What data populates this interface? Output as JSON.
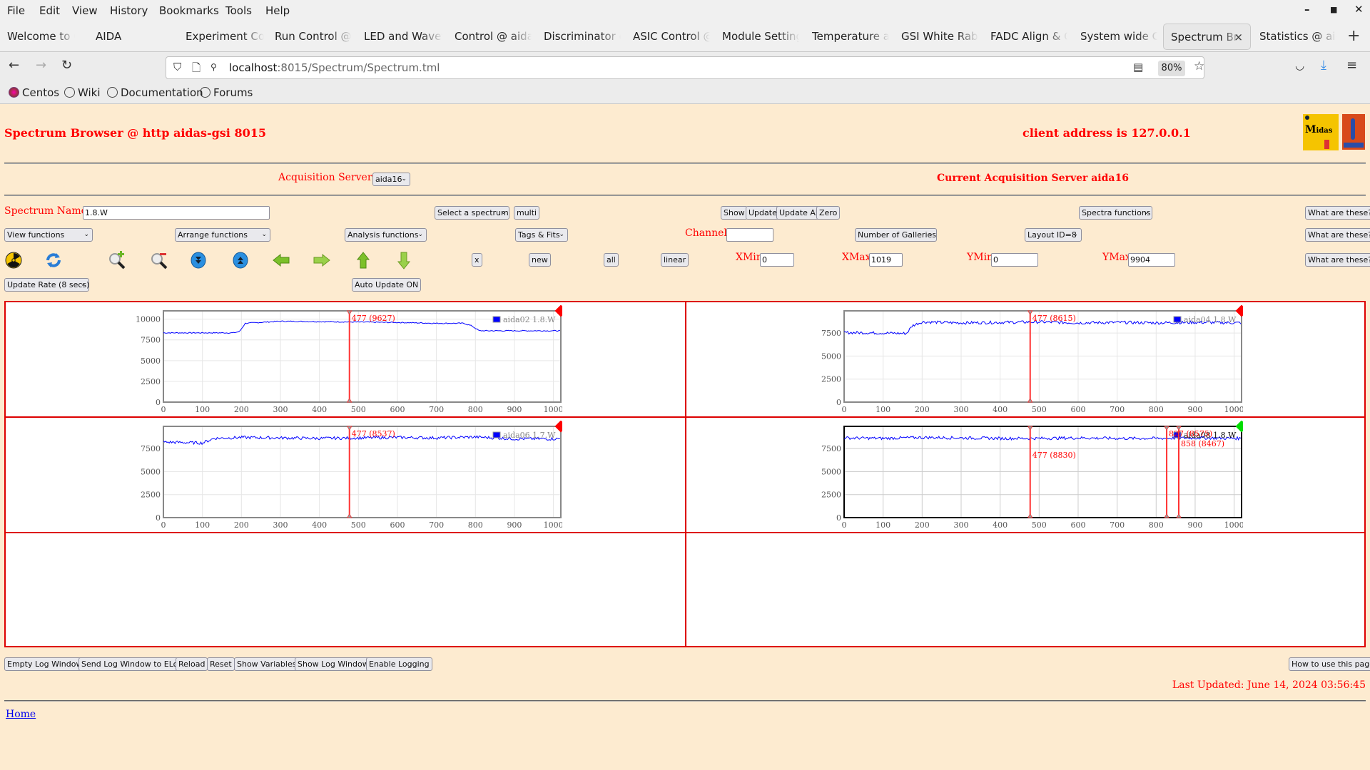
{
  "browser": {
    "menu": [
      "File",
      "Edit",
      "View",
      "History",
      "Bookmarks",
      "Tools",
      "Help"
    ],
    "tabs": [
      {
        "label": "Welcome to Centos",
        "active": false
      },
      {
        "label": "AIDA",
        "active": false
      },
      {
        "label": "Experiment Control",
        "active": false
      },
      {
        "label": "Run Control @ aidas",
        "active": false
      },
      {
        "label": "LED and Waveform",
        "active": false
      },
      {
        "label": "Control @ aidas",
        "active": false
      },
      {
        "label": "Discriminator control",
        "active": false
      },
      {
        "label": "ASIC Control @",
        "active": false
      },
      {
        "label": "Module Settings",
        "active": false
      },
      {
        "label": "Temperature and",
        "active": false
      },
      {
        "label": "GSI White Rabbit",
        "active": false
      },
      {
        "label": "FADC Align & Control",
        "active": false
      },
      {
        "label": "System wide Checks",
        "active": false
      },
      {
        "label": "Spectrum Browser",
        "active": true
      },
      {
        "label": "Statistics @ aidas",
        "active": false
      }
    ],
    "url_host": "localhost",
    "url_rest": ":8015/Spectrum/Spectrum.tml",
    "zoom_level": "80%",
    "bookmarks": [
      "Centos",
      "Wiki",
      "Documentation",
      "Forums"
    ]
  },
  "page": {
    "title": "Spectrum Browser @ http aidas-gsi 8015",
    "client_address": "client address is 127.0.0.1",
    "acq_servers_label": "Acquisition Servers",
    "acq_server_selected": "aida16",
    "current_server": "Current Acquisition Server aida16",
    "spectrum_name_label": "Spectrum Name:",
    "spectrum_name_value": "1.8.W",
    "select_spectrum": "Select a spectrum",
    "multi": "multi",
    "show": "Show",
    "update": "Update",
    "update_all": "Update All",
    "zero": "Zero",
    "spectra_functions": "Spectra functions",
    "what_are_these": "What are these?",
    "view_functions": "View functions",
    "arrange_functions": "Arrange functions",
    "analysis_functions": "Analysis functions",
    "tags_fits": "Tags & Fits",
    "channel_label": "Channel:",
    "channel_value": "",
    "number_of_galleries": "Number of Galleries",
    "layout_id": "Layout ID=8",
    "x_btn": "x",
    "new_btn": "new",
    "all_btn": "all",
    "linear_btn": "linear",
    "xmin_label": "XMin",
    "xmin_value": "0",
    "xmax_label": "XMax",
    "xmax_value": "1019",
    "ymin_label": "YMin",
    "ymin_value": "0",
    "ymax_label": "YMax",
    "ymax_value": "9904",
    "update_rate": "Update Rate (8 secs)",
    "auto_update": "Auto Update ON",
    "bottom_buttons": [
      "Empty Log Window",
      "Send Log Window to ELog",
      "Reload",
      "Reset",
      "Show Variables",
      "Show Log Window",
      "Enable Logging"
    ],
    "how_to_use": "How to use this page",
    "last_updated": "Last Updated: June 14, 2024 03:56:45",
    "home_link": "Home",
    "toolbar_icons": [
      "radiation-icon",
      "refresh-icon",
      "zoom-in-icon",
      "zoom-out-icon",
      "expand-down-icon",
      "expand-up-icon",
      "arrow-left-icon",
      "arrow-right-icon",
      "arrow-up-icon",
      "arrow-down-icon"
    ],
    "colors": {
      "background": "#fdebd0",
      "accent": "#ff0000",
      "series": "#0000ff",
      "marker": "#ff0000",
      "selected_marker": "#00dd00"
    }
  },
  "chart_data": [
    {
      "type": "line",
      "legend": "aida02 1.8.W",
      "xlim": [
        0,
        1019
      ],
      "ylim": [
        0,
        11000
      ],
      "xticks": [
        0,
        100,
        200,
        300,
        400,
        500,
        600,
        700,
        800,
        900,
        1000
      ],
      "yticks": [
        0,
        2500,
        5000,
        7500,
        10000
      ],
      "series": [
        {
          "name": "aida02 1.8.W",
          "x": [
            0,
            180,
            195,
            210,
            300,
            400,
            500,
            600,
            700,
            770,
            790,
            810,
            900,
            1019
          ],
          "y": [
            8350,
            8350,
            8500,
            9500,
            9750,
            9700,
            9650,
            9600,
            9500,
            9500,
            9200,
            8600,
            8600,
            8600
          ]
        }
      ],
      "cursors": [
        {
          "x": 477,
          "label": "477 (9627)"
        }
      ],
      "status": "red",
      "selected": false
    },
    {
      "type": "line",
      "legend": "aida04 1.8.W",
      "xlim": [
        0,
        1019
      ],
      "ylim": [
        0,
        9904
      ],
      "xticks": [
        0,
        100,
        200,
        300,
        400,
        500,
        600,
        700,
        800,
        900,
        1000
      ],
      "yticks": [
        0,
        2500,
        5000,
        7500
      ],
      "series": [
        {
          "name": "aida04 1.8.W",
          "x": [
            0,
            100,
            160,
            175,
            200,
            300,
            400,
            500,
            600,
            700,
            800,
            900,
            1019
          ],
          "y": [
            7550,
            7500,
            7450,
            8300,
            8700,
            8600,
            8650,
            8700,
            8600,
            8650,
            8600,
            8650,
            8600
          ]
        }
      ],
      "cursors": [
        {
          "x": 477,
          "label": "477 (8615)"
        }
      ],
      "status": "red",
      "selected": false
    },
    {
      "type": "line",
      "legend": "aida06 1.7.W",
      "xlim": [
        0,
        1019
      ],
      "ylim": [
        0,
        9904
      ],
      "xticks": [
        0,
        100,
        200,
        300,
        400,
        500,
        600,
        700,
        800,
        900,
        1000
      ],
      "yticks": [
        0,
        2500,
        5000,
        7500
      ],
      "series": [
        {
          "name": "aida06 1.7.W",
          "x": [
            0,
            50,
            100,
            130,
            200,
            300,
            400,
            500,
            600,
            700,
            800,
            900,
            1019
          ],
          "y": [
            8200,
            8150,
            8100,
            8600,
            8700,
            8650,
            8600,
            8650,
            8700,
            8650,
            8750,
            8550,
            8550
          ]
        }
      ],
      "cursors": [
        {
          "x": 477,
          "label": "477 (8537)"
        }
      ],
      "status": "red",
      "selected": false
    },
    {
      "type": "line",
      "legend": "aida08 1.8.W",
      "xlim": [
        0,
        1019
      ],
      "ylim": [
        0,
        9904
      ],
      "xticks": [
        0,
        100,
        200,
        300,
        400,
        500,
        600,
        700,
        800,
        900,
        1000
      ],
      "yticks": [
        0,
        2500,
        5000,
        7500
      ],
      "series": [
        {
          "name": "aida08 1.8.W",
          "x": [
            0,
            100,
            200,
            300,
            400,
            500,
            600,
            700,
            800,
            900,
            1019
          ],
          "y": [
            8650,
            8600,
            8700,
            8650,
            8600,
            8600,
            8650,
            8600,
            8600,
            8650,
            8600
          ]
        }
      ],
      "cursors": [
        {
          "x": 477,
          "label": "477 (8830)"
        },
        {
          "x": 827,
          "label": "827 (8575)"
        },
        {
          "x": 858,
          "label": "858 (8467)"
        }
      ],
      "status": "green",
      "selected": true
    }
  ]
}
